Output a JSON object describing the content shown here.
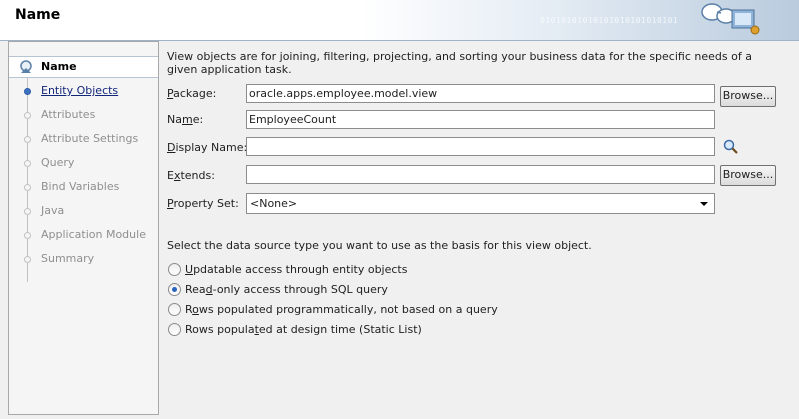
{
  "header": {
    "title": "Name",
    "binary": "01010101010101010101010101"
  },
  "nav": {
    "items": [
      {
        "label": "Name",
        "state": "active"
      },
      {
        "label": "Entity Objects",
        "state": "link"
      },
      {
        "label": "Attributes",
        "state": "disabled"
      },
      {
        "label": "Attribute Settings",
        "state": "disabled"
      },
      {
        "label": "Query",
        "state": "disabled"
      },
      {
        "label": "Bind Variables",
        "state": "disabled"
      },
      {
        "label": "Java",
        "state": "disabled"
      },
      {
        "label": "Application Module",
        "state": "disabled"
      },
      {
        "label": "Summary",
        "state": "disabled"
      }
    ]
  },
  "form": {
    "description": "View objects are for joining, filtering, projecting, and sorting your business data for the specific needs of a given application task.",
    "package": {
      "label_pre": "",
      "label_mn": "P",
      "label_post": "ackage:",
      "value": "oracle.apps.employee.model.view",
      "browse": "Browse..."
    },
    "name": {
      "label_pre": "Na",
      "label_mn": "m",
      "label_post": "e:",
      "value": "EmployeeCount"
    },
    "display_name": {
      "label_pre": "",
      "label_mn": "D",
      "label_post": "isplay Name:",
      "value": ""
    },
    "extends": {
      "label_pre": "E",
      "label_mn": "x",
      "label_post": "tends:",
      "value": "",
      "browse": "Browse..."
    },
    "property_set": {
      "label_pre": "",
      "label_mn": "P",
      "label_post": "roperty Set:",
      "value": "<None>"
    },
    "datasource_prompt": "Select the data source type you want to use as the basis for this view object.",
    "options": [
      {
        "pre": "",
        "mn": "U",
        "post": "pdatable access through entity objects",
        "checked": false
      },
      {
        "pre": "Rea",
        "mn": "d",
        "post": "-only access through SQL query",
        "checked": true
      },
      {
        "pre": "R",
        "mn": "o",
        "post": "ws populated programmatically, not based on a query",
        "checked": false
      },
      {
        "pre": "Rows popula",
        "mn": "t",
        "post": "ed at design time (Static List)",
        "checked": false
      }
    ]
  }
}
